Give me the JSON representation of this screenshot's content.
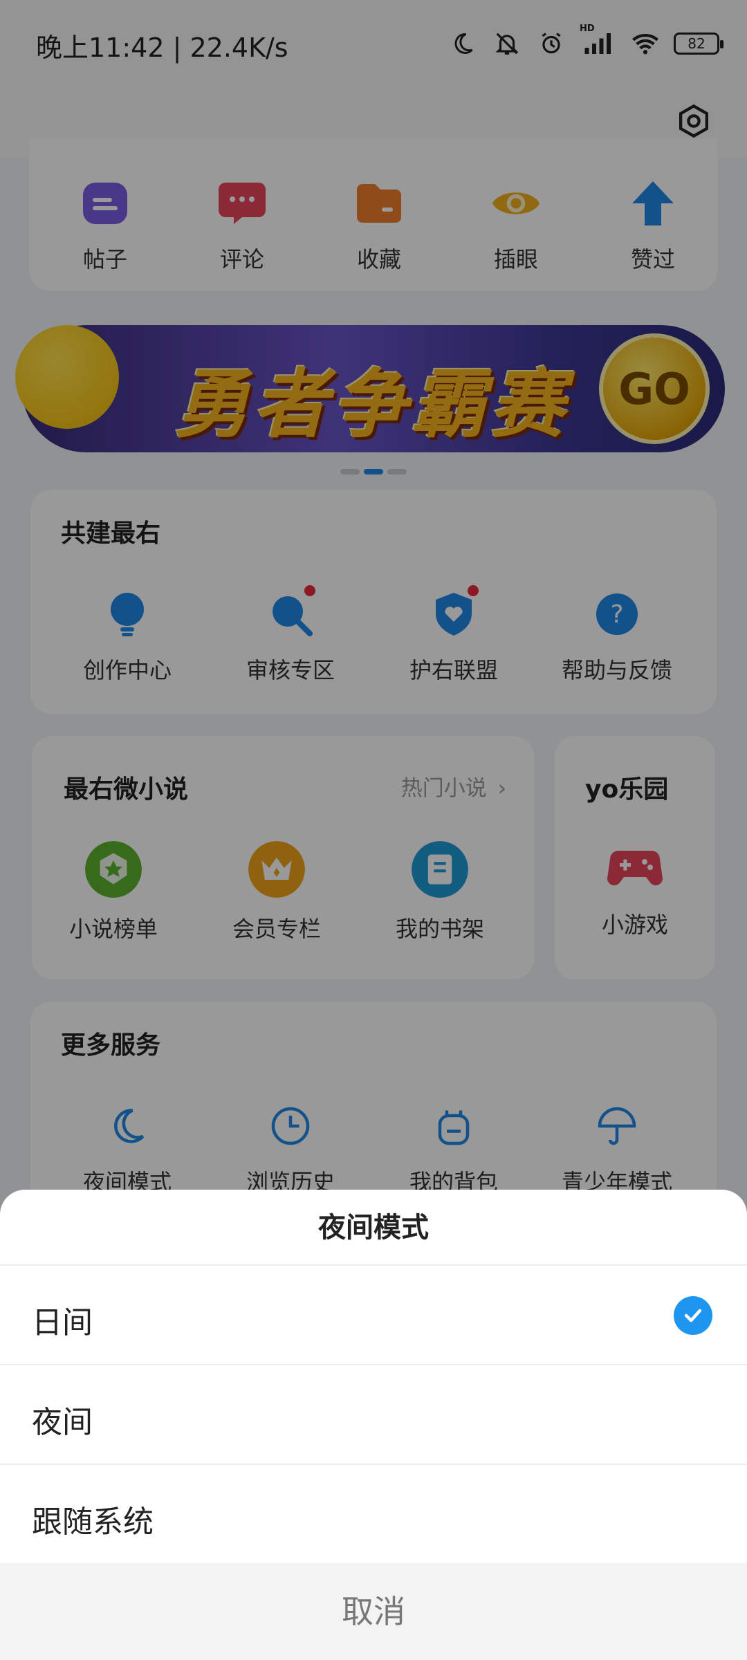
{
  "status_bar": {
    "time": "晚上11:42 | 22.4K/s",
    "battery": "82",
    "network_label": "HD"
  },
  "quick_actions": [
    {
      "label": "帖子",
      "icon": "post-icon",
      "color": "#7b5ee6"
    },
    {
      "label": "评论",
      "icon": "comment-icon",
      "color": "#e8455a"
    },
    {
      "label": "收藏",
      "icon": "folder-icon",
      "color": "#ef7d2a"
    },
    {
      "label": "插眼",
      "icon": "eye-icon",
      "color": "#f2b01e"
    },
    {
      "label": "赞过",
      "icon": "thumb-up-icon",
      "color": "#1e88e5"
    }
  ],
  "banner": {
    "text": "勇者争霸赛",
    "go_label": "GO"
  },
  "co_build": {
    "title": "共建最右",
    "items": [
      {
        "label": "创作中心",
        "icon": "bulb-icon",
        "badge": false
      },
      {
        "label": "审核专区",
        "icon": "magnifier-icon",
        "badge": true
      },
      {
        "label": "护右联盟",
        "icon": "shield-heart-icon",
        "badge": true
      },
      {
        "label": "帮助与反馈",
        "icon": "help-icon",
        "badge": false
      }
    ]
  },
  "novel": {
    "title": "最右微小说",
    "link": "热门小说",
    "items": [
      {
        "label": "小说榜单",
        "icon": "ranking-badge-icon",
        "color": "#5cb22f"
      },
      {
        "label": "会员专栏",
        "icon": "crown-icon",
        "color": "#f0a21a"
      },
      {
        "label": "我的书架",
        "icon": "book-icon",
        "color": "#1e9ad6"
      }
    ]
  },
  "yo_park": {
    "title": "yo乐园",
    "items": [
      {
        "label": "小游戏",
        "icon": "gamepad-icon",
        "color": "#e8455a"
      }
    ]
  },
  "more_services": {
    "title": "更多服务",
    "items": [
      {
        "label": "夜间模式",
        "icon": "moon-icon"
      },
      {
        "label": "浏览历史",
        "icon": "clock-icon"
      },
      {
        "label": "我的背包",
        "icon": "backpack-icon"
      },
      {
        "label": "青少年模式",
        "icon": "umbrella-icon"
      }
    ]
  },
  "sheet": {
    "title": "夜间模式",
    "options": [
      {
        "label": "日间",
        "selected": true
      },
      {
        "label": "夜间",
        "selected": false
      },
      {
        "label": "跟随系统",
        "selected": false
      }
    ],
    "cancel": "取消"
  },
  "colors": {
    "accent": "#1e96f0",
    "dim_overlay": "rgba(0,0,0,0.40)"
  }
}
